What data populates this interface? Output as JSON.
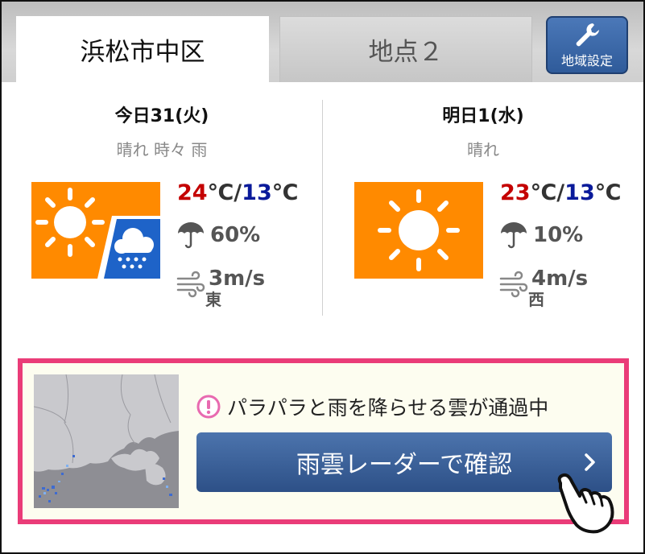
{
  "tabs": [
    {
      "label": "浜松市中区",
      "active": true
    },
    {
      "label": "地点２",
      "active": false
    }
  ],
  "settings_button": {
    "label": "地域設定",
    "icon": "wrench-icon"
  },
  "today": {
    "date": "今日31(火)",
    "condition": "晴れ 時々 雨",
    "icon": "sun-then-rain-icon",
    "temp_high": "24",
    "temp_low": "13",
    "temp_unit": "℃",
    "temp_sep": "/",
    "rain_chance": "60%",
    "wind_speed": "3m/s",
    "wind_dir": "東"
  },
  "tomorrow": {
    "date": "明日1(水)",
    "condition": "晴れ",
    "icon": "sun-icon",
    "temp_high": "23",
    "temp_low": "13",
    "temp_unit": "℃",
    "temp_sep": "/",
    "rain_chance": "10%",
    "wind_speed": "4m/s",
    "wind_dir": "西"
  },
  "alert": {
    "message": "パラパラと雨を降らせる雲が通過中",
    "button_label": "雨雲レーダーで確認"
  },
  "colors": {
    "accent_pink": "#ea3c78",
    "button_blue": "#3a6099",
    "icon_orange": "#ff8a00",
    "temp_high": "#c40000",
    "temp_low": "#0a1a9a"
  }
}
